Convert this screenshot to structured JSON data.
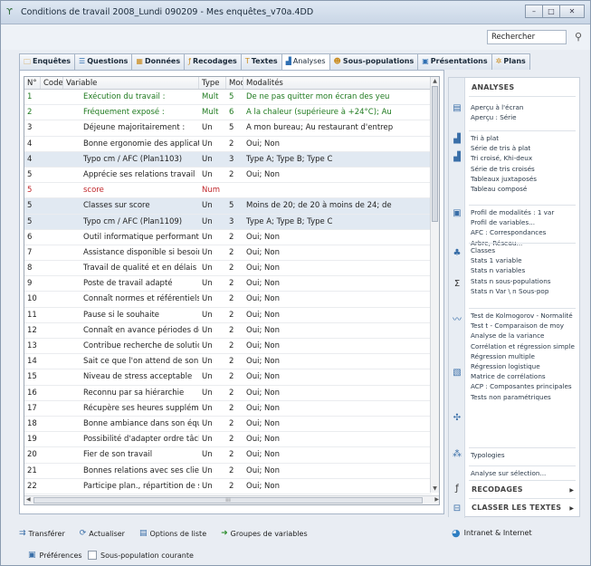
{
  "window": {
    "title": "Conditions de travail 2008_Lundi 090209 - Mes enquêtes_v70a.4DD",
    "controls": [
      "minimize",
      "maximize",
      "close"
    ]
  },
  "search": {
    "value": "Rechercher"
  },
  "tabs": [
    {
      "label": "Enquêtes",
      "icon": "folder-icon",
      "active": false
    },
    {
      "label": "Questions",
      "icon": "list-icon",
      "active": false
    },
    {
      "label": "Données",
      "icon": "table-icon",
      "active": false
    },
    {
      "label": "Recodages",
      "icon": "fx-icon",
      "active": false
    },
    {
      "label": "Textes",
      "icon": "text-icon",
      "active": false
    },
    {
      "label": "Analyses",
      "icon": "bar-chart-icon",
      "active": true
    },
    {
      "label": "Sous-populations",
      "icon": "people-icon",
      "active": false
    },
    {
      "label": "Présentations",
      "icon": "presentation-icon",
      "active": false
    },
    {
      "label": "Plans",
      "icon": "gear-icon",
      "active": false
    }
  ],
  "grid": {
    "headers": [
      "N°",
      "Code",
      "Variable",
      "Type",
      "Mod.",
      "Modalités"
    ],
    "rows": [
      {
        "n": "1",
        "code": "",
        "variable": "Exécution du travail :",
        "type": "Mult",
        "mod": "5",
        "modalites": "De ne pas quitter mon écran des yeu",
        "color": "green",
        "selected": false
      },
      {
        "n": "2",
        "code": "",
        "variable": "Fréquement exposé :",
        "type": "Mult",
        "mod": "6",
        "modalites": "A la chaleur (supérieure à +24°C); Au",
        "color": "green",
        "selected": false
      },
      {
        "n": "3",
        "code": "",
        "variable": "Déjeune majoritairement :",
        "type": "Un",
        "mod": "5",
        "modalites": "A mon bureau; Au restaurant d'entrep",
        "color": "normal",
        "selected": false
      },
      {
        "n": "4",
        "code": "",
        "variable": "Bonne ergonomie des applications infor.",
        "type": "Un",
        "mod": "2",
        "modalites": "Oui; Non",
        "color": "normal",
        "selected": false
      },
      {
        "n": "4",
        "code": "",
        "variable": "Typo cm / AFC (Plan1103)",
        "type": "Un",
        "mod": "3",
        "modalites": "Type A; Type B; Type C",
        "color": "normal",
        "selected": true
      },
      {
        "n": "5",
        "code": "",
        "variable": "Apprécie ses relations travail",
        "type": "Un",
        "mod": "2",
        "modalites": "Oui; Non",
        "color": "normal",
        "selected": false
      },
      {
        "n": "5",
        "code": "",
        "variable": "score",
        "type": "Num",
        "mod": "",
        "modalites": "",
        "color": "red",
        "selected": false
      },
      {
        "n": "5",
        "code": "",
        "variable": "Classes sur score",
        "type": "Un",
        "mod": "5",
        "modalites": "Moins de 20; de 20 à moins de 24; de",
        "color": "normal",
        "selected": true
      },
      {
        "n": "5",
        "code": "",
        "variable": "Typo cm / AFC (Plan1109)",
        "type": "Un",
        "mod": "3",
        "modalites": "Type A; Type B; Type C",
        "color": "normal",
        "selected": true
      },
      {
        "n": "6",
        "code": "",
        "variable": "Outil informatique performant",
        "type": "Un",
        "mod": "2",
        "modalites": "Oui; Non",
        "color": "normal",
        "selected": false
      },
      {
        "n": "7",
        "code": "",
        "variable": "Assistance disponible si besoin",
        "type": "Un",
        "mod": "2",
        "modalites": "Oui; Non",
        "color": "normal",
        "selected": false
      },
      {
        "n": "8",
        "code": "",
        "variable": "Travail de qualité et en délais",
        "type": "Un",
        "mod": "2",
        "modalites": "Oui; Non",
        "color": "normal",
        "selected": false
      },
      {
        "n": "9",
        "code": "",
        "variable": "Poste de travail adapté",
        "type": "Un",
        "mod": "2",
        "modalites": "Oui; Non",
        "color": "normal",
        "selected": false
      },
      {
        "n": "10",
        "code": "",
        "variable": "Connaît normes et référentiels",
        "type": "Un",
        "mod": "2",
        "modalites": "Oui; Non",
        "color": "normal",
        "selected": false
      },
      {
        "n": "11",
        "code": "",
        "variable": "Pause si le souhaite",
        "type": "Un",
        "mod": "2",
        "modalites": "Oui; Non",
        "color": "normal",
        "selected": false
      },
      {
        "n": "12",
        "code": "",
        "variable": "Connaît en avance périodes de pointe",
        "type": "Un",
        "mod": "2",
        "modalites": "Oui; Non",
        "color": "normal",
        "selected": false
      },
      {
        "n": "13",
        "code": "",
        "variable": "Contribue recherche de solutions",
        "type": "Un",
        "mod": "2",
        "modalites": "Oui; Non",
        "color": "normal",
        "selected": false
      },
      {
        "n": "14",
        "code": "",
        "variable": "Sait ce que l'on attend de son travail",
        "type": "Un",
        "mod": "2",
        "modalites": "Oui; Non",
        "color": "normal",
        "selected": false
      },
      {
        "n": "15",
        "code": "",
        "variable": "Niveau de stress acceptable",
        "type": "Un",
        "mod": "2",
        "modalites": "Oui; Non",
        "color": "normal",
        "selected": false
      },
      {
        "n": "16",
        "code": "",
        "variable": "Reconnu par sa hiérarchie",
        "type": "Un",
        "mod": "2",
        "modalites": "Oui; Non",
        "color": "normal",
        "selected": false
      },
      {
        "n": "17",
        "code": "",
        "variable": "Récupère ses heures supplémentaires",
        "type": "Un",
        "mod": "2",
        "modalites": "Oui; Non",
        "color": "normal",
        "selected": false
      },
      {
        "n": "18",
        "code": "",
        "variable": "Bonne ambiance dans son équipe",
        "type": "Un",
        "mod": "2",
        "modalites": "Oui; Non",
        "color": "normal",
        "selected": false
      },
      {
        "n": "19",
        "code": "",
        "variable": "Possibilité d'adapter ordre tâches à accc",
        "type": "Un",
        "mod": "2",
        "modalites": "Oui; Non",
        "color": "normal",
        "selected": false
      },
      {
        "n": "20",
        "code": "",
        "variable": "Fier de son travail",
        "type": "Un",
        "mod": "2",
        "modalites": "Oui; Non",
        "color": "normal",
        "selected": false
      },
      {
        "n": "21",
        "code": "",
        "variable": "Bonnes relations avec ses clients",
        "type": "Un",
        "mod": "2",
        "modalites": "Oui; Non",
        "color": "normal",
        "selected": false
      },
      {
        "n": "22",
        "code": "",
        "variable": "Participe plan., répartition de son travail",
        "type": "Un",
        "mod": "2",
        "modalites": "Oui; Non",
        "color": "normal",
        "selected": false
      }
    ]
  },
  "sidebar": {
    "heading": "ANALYSES",
    "items": [
      "Aperçu à l'écran",
      "Aperçu : Série",
      "Tri à plat",
      "Série de tris à plat",
      "Tri croisé, Khi-deux",
      "Série de tris croisés",
      "Tableaux juxtaposés",
      "Tableau composé",
      "Profil de modalités : 1 var",
      "Profil de variables...",
      "AFC : Correspondances",
      "Arbre, Réseau...",
      "Classes",
      "Stats 1 variable",
      "Stats n variables",
      "Stats n sous-populations",
      "Stats n Var \\ n Sous-pop",
      "Test de Kolmogorov - Normalité",
      "Test t - Comparaison de moy",
      "Analyse de la variance",
      "Corrélation et régression simple",
      "Régression multiple",
      "Régression logistique",
      "Matrice de corrélations",
      "ACP : Composantes principales",
      "Tests non paramétriques",
      "Typologies",
      "Analyse sur sélection..."
    ],
    "recodages": "RECODAGES",
    "classer": "CLASSER LES TEXTES"
  },
  "toolbar": {
    "transferer": "Transférer",
    "actualiser": "Actualiser",
    "options": "Options de liste",
    "groupes": "Groupes de variables"
  },
  "intranet": "Intranet & Internet",
  "bottom": {
    "preferences": "Préférences",
    "sous_pop": "Sous-population courante"
  },
  "colors": {
    "green_text": "#1f7a1f",
    "red_text": "#c0262a",
    "selected_row": "#e1e9f2",
    "accent": "#3a6fa8"
  }
}
